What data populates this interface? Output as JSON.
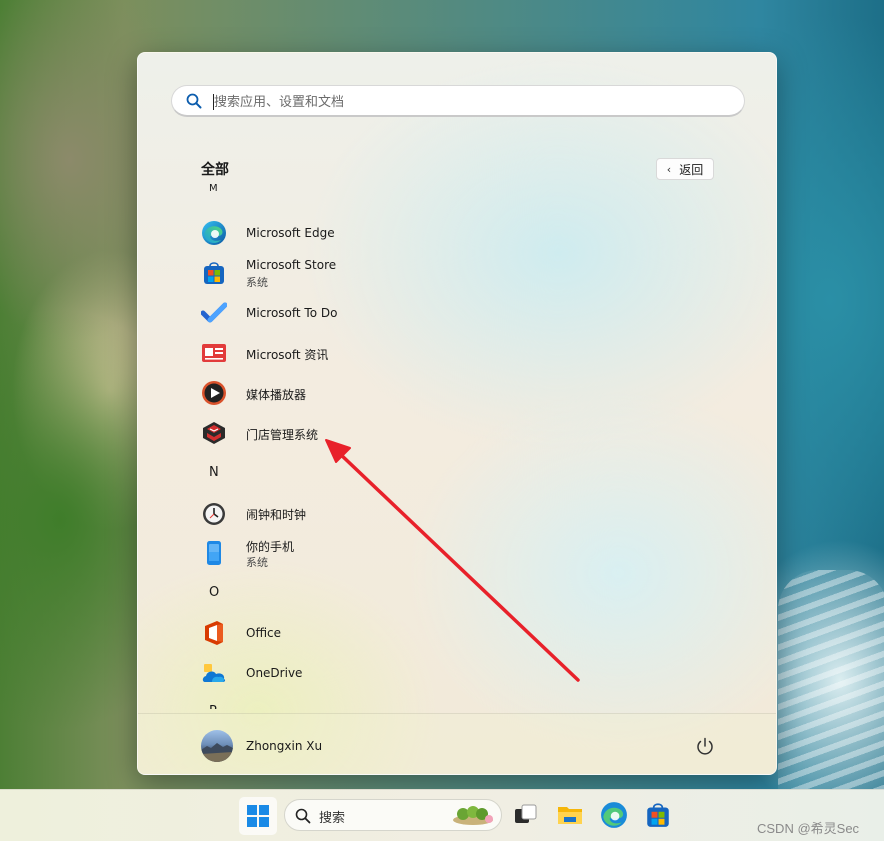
{
  "search": {
    "placeholder": "搜索应用、设置和文档"
  },
  "all_apps": {
    "title": "全部",
    "back_label": "返回",
    "back_chevron": "‹"
  },
  "list": {
    "letter_m": "M",
    "letter_n": "N",
    "letter_o": "O",
    "letter_p": "P",
    "apps": [
      {
        "name": "Microsoft Edge",
        "icon": "edge-icon"
      },
      {
        "name": "Microsoft Store",
        "subtitle": "系统",
        "icon": "store-icon"
      },
      {
        "name": "Microsoft To Do",
        "icon": "todo-icon"
      },
      {
        "name": "Microsoft 资讯",
        "icon": "news-icon"
      },
      {
        "name": "媒体播放器",
        "icon": "media-player-icon"
      },
      {
        "name": "门店管理系统",
        "icon": "store-management-icon"
      },
      {
        "name": "闹钟和时钟",
        "icon": "clock-icon"
      },
      {
        "name": "你的手机",
        "subtitle": "系统",
        "icon": "phone-link-icon"
      },
      {
        "name": "Office",
        "icon": "office-icon"
      },
      {
        "name": "OneDrive",
        "icon": "onedrive-icon"
      }
    ]
  },
  "user": {
    "name": "Zhongxin Xu"
  },
  "taskbar": {
    "search_label": "搜索"
  },
  "watermark": "CSDN @希灵Sec",
  "colors": {
    "annotation_arrow": "#e8212a",
    "accent": "#0078d4"
  }
}
